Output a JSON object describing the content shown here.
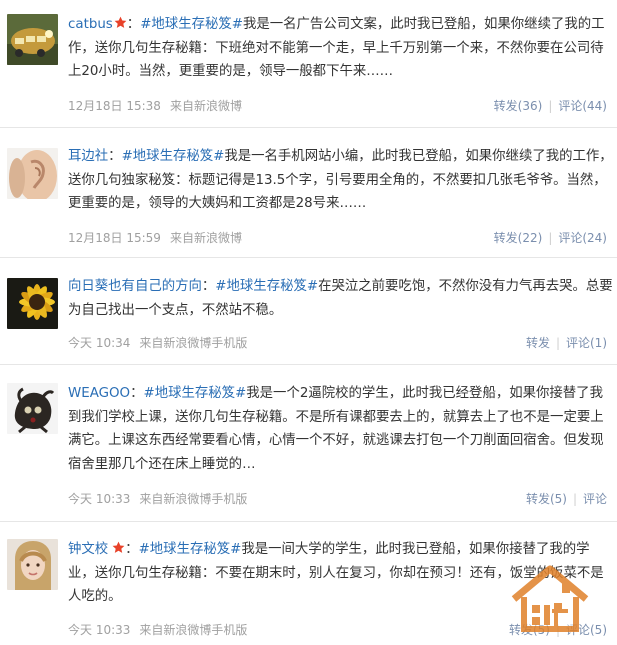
{
  "posts": [
    {
      "author": "catbus",
      "verified": true,
      "colon": "：",
      "topic": "#地球生存秘笈#",
      "text": "我是一名广告公司文案，此时我已登船，如果你继续了我的工作，送你几句生存秘籍：下班绝对不能第一个走，早上千万别第一个来，不然你要在公司待上20小时。当然，更重要的是，领导一般都下午来……",
      "time": "12月18日 15:38",
      "source": "来自新浪微博",
      "repost": "转发(36)",
      "comment": "评论(44)",
      "sep": "|"
    },
    {
      "author": "耳边社",
      "verified": false,
      "colon": "：",
      "topic": "#地球生存秘笈#",
      "text": "我是一名手机网站小编，此时我已登船，如果你继续了我的工作，送你几句独家秘笈：标题记得是13.5个字，引号要用全角的，不然要扣几张毛爷爷。当然，更重要的是，领导的大姨妈和工资都是28号来……",
      "time": "12月18日 15:59",
      "source": "来自新浪微博",
      "repost": "转发(22)",
      "comment": "评论(24)",
      "sep": "|"
    },
    {
      "author": "向日葵也有自己的方向",
      "verified": false,
      "colon": "：",
      "topic": "#地球生存秘笈#",
      "text": "在哭泣之前要吃饱，不然你没有力气再去哭。总要为自己找出一个支点，不然站不稳。",
      "time": "今天 10:34",
      "source": "来自新浪微博手机版",
      "repost": "转发",
      "comment": "评论(1)",
      "sep": "|"
    },
    {
      "author": "WEAGOO",
      "verified": false,
      "colon": "：",
      "topic": "#地球生存秘笈#",
      "text": "我是一个2逼院校的学生，此时我已经登船，如果你接替了我到我们学校上课，送你几句生存秘籍。不是所有课都要去上的，就算去上了也不是一定要上满它。上课这东西经常要看心情，心情一个不好，就逃课去打包一个刀削面回宿舍。但发现宿舍里那几个还在床上睡觉的…",
      "time": "今天 10:33",
      "source": "来自新浪微博手机版",
      "repost": "转发(5)",
      "comment": "评论",
      "sep": "|"
    },
    {
      "author": "钟文校",
      "verified": true,
      "colon": "：",
      "topic": "#地球生存秘笈#",
      "text": "我是一间大学的学生，此时我已登船，如果你接替了我的学业，送你几句生存秘籍：不要在期末时，别人在复习，你却在预习！还有，饭堂的饭菜不是人吃的。",
      "time": "今天 10:33",
      "source": "来自新浪微博手机版",
      "repost": "转发(5)",
      "comment": "评论(5)",
      "sep": "|"
    }
  ],
  "colors": {
    "link": "#2a6eb5",
    "text": "#333333",
    "meta": "#999999",
    "divider": "#e6e6e6",
    "verified_star": "#e8422a",
    "watermark": "#e0812a"
  },
  "icons": {
    "verified": "red-star-icon",
    "watermark": "house-logo-watermark"
  }
}
